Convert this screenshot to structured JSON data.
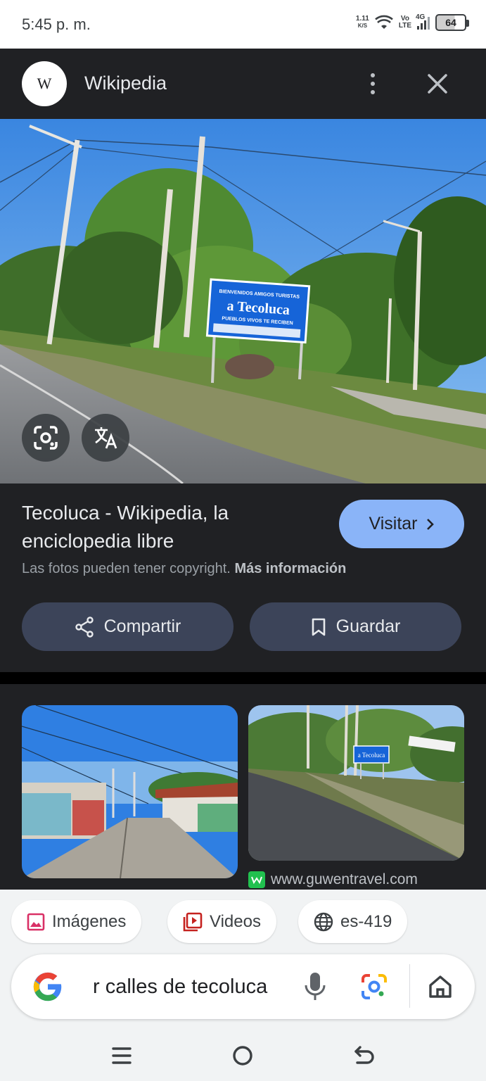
{
  "status_bar": {
    "time": "5:45 p. m.",
    "net_speed_value": "1.11",
    "net_speed_unit": "K/S",
    "volte_top": "Vo",
    "volte_bottom": "LTE",
    "network": "4G",
    "battery": "64"
  },
  "header": {
    "logo_letter": "W",
    "site_name": "Wikipedia",
    "icons": [
      "more-vert-icon",
      "close-icon"
    ]
  },
  "hero": {
    "sign_line1": "BIENVENIDOS AMIGOS TURISTAS",
    "sign_line2": "a Tecoluca",
    "sign_line3": "PUEBLOS VIVOS TE RECIBEN"
  },
  "result": {
    "title": "Tecoluca - Wikipedia, la enciclopedia libre",
    "visit_label": "Visitar",
    "copyright_text": "Las fotos pueden tener copyright.",
    "more_info_label": "Más información",
    "share_label": "Compartir",
    "save_label": "Guardar"
  },
  "related": {
    "source_domain": "www.guwentravel.com",
    "thumb2_sign": "a Tecoluca"
  },
  "chips": [
    {
      "label": "Imágenes",
      "icon": "image-icon"
    },
    {
      "label": "Videos",
      "icon": "video-icon"
    },
    {
      "label": "es-419",
      "icon": "globe-icon"
    }
  ],
  "search": {
    "query": "r calles de tecoluca"
  },
  "colors": {
    "accent": "#8ab4f8",
    "dark_bg": "#202124",
    "button_bg": "#3c4459"
  }
}
